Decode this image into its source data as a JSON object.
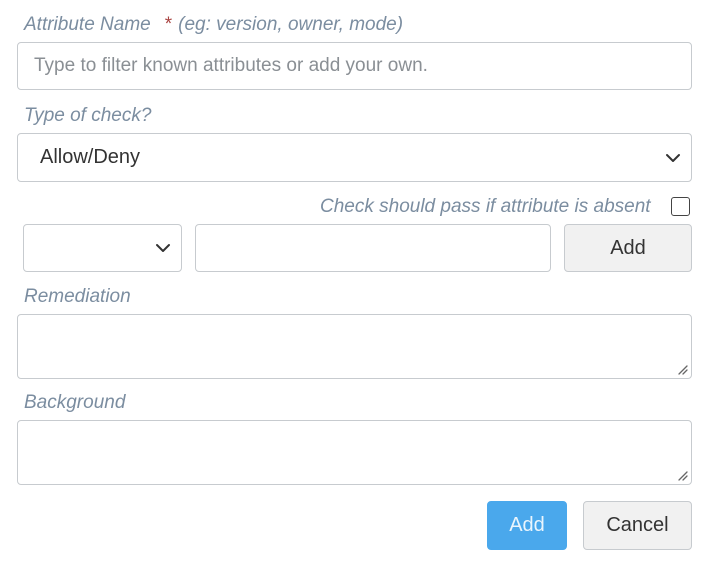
{
  "attribute_name": {
    "label": "Attribute Name",
    "required_marker": "*",
    "hint": "(eg: version, owner, mode)",
    "placeholder": "Type to filter known attributes or add your own.",
    "value": ""
  },
  "check_type": {
    "label": "Type of check?",
    "selected": "Allow/Deny"
  },
  "absent_option": {
    "label": "Check should pass if attribute is absent",
    "checked": false
  },
  "value_row": {
    "operator_selected": "",
    "value_input": "",
    "add_label": "Add"
  },
  "remediation": {
    "label": "Remediation",
    "value": ""
  },
  "background": {
    "label": "Background",
    "value": ""
  },
  "footer": {
    "add_label": "Add",
    "cancel_label": "Cancel"
  },
  "colors": {
    "label_text": "#7b8da0",
    "required_star": "#a94442",
    "primary_button": "#4aa8ec",
    "border": "#c7cbcf"
  }
}
